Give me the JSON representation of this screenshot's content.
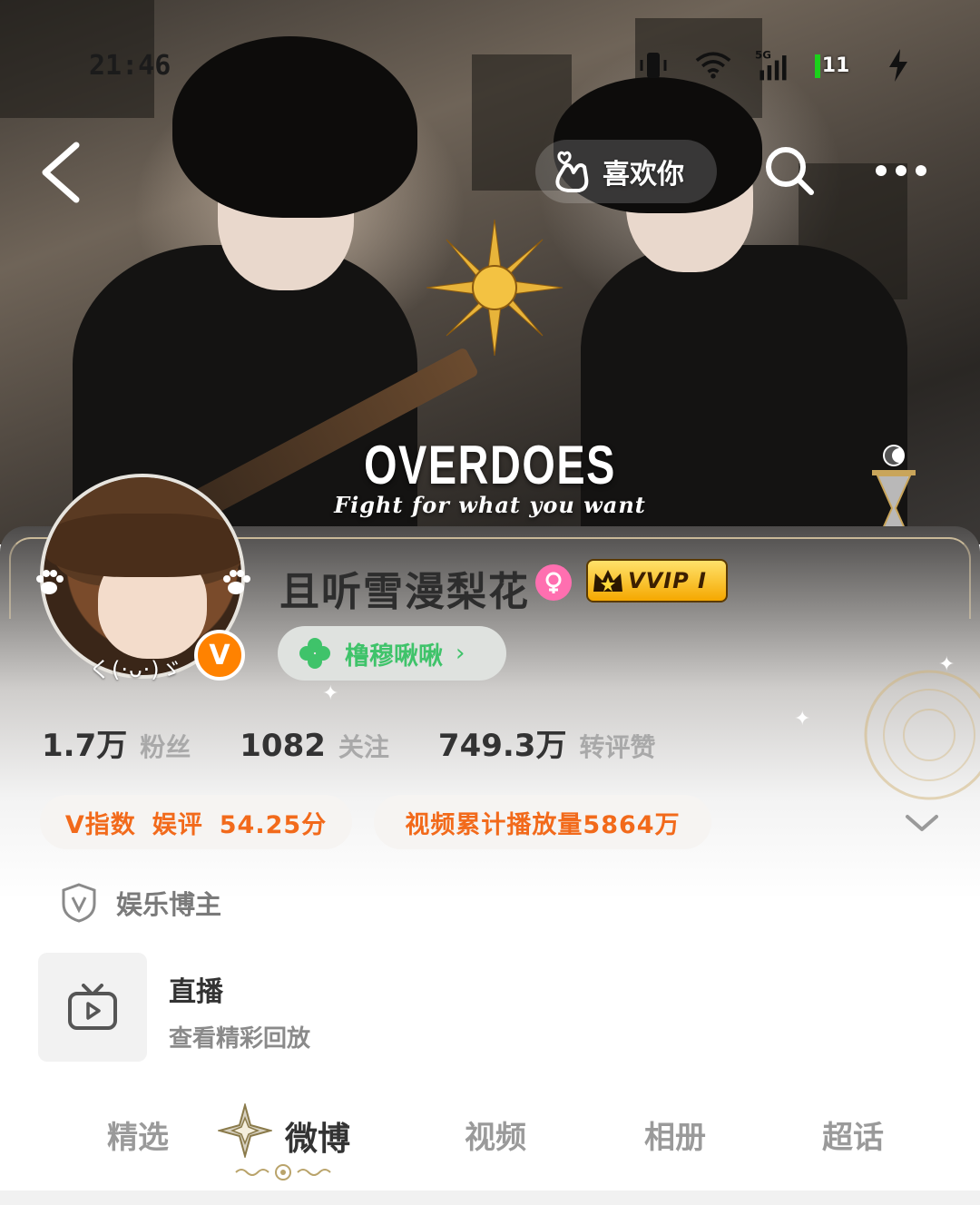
{
  "status_bar": {
    "time": "21:46",
    "network": "5G",
    "battery": "11"
  },
  "top_nav": {
    "like_label": "喜欢你"
  },
  "banner": {
    "title": "OVERDOES",
    "tagline": "Fight for what you want"
  },
  "profile": {
    "username": "且听雪漫梨花",
    "vip_label": "VVIP I",
    "fan_group": "橹穆啾啾",
    "kaomoji": "く(·ᴗ·)ゞ",
    "verified": "V"
  },
  "stats": [
    {
      "value": "1.7万",
      "label": "粉丝"
    },
    {
      "value": "1082",
      "label": "关注"
    },
    {
      "value": "749.3万",
      "label": "转评赞"
    }
  ],
  "chips": {
    "v_index": {
      "label": "V指数",
      "category": "娱评",
      "score": "54.25分"
    },
    "video_plays": "视频累计播放量5864万"
  },
  "tag": "娱乐博主",
  "live": {
    "title": "直播",
    "subtitle": "查看精彩回放"
  },
  "tabs": [
    "精选",
    "微博",
    "视频",
    "相册",
    "超话"
  ],
  "colors": {
    "accent": "#f26a1b",
    "verified": "#ff8200",
    "fan_green": "#3fc36a",
    "gender_pink": "#ff6fb0"
  }
}
